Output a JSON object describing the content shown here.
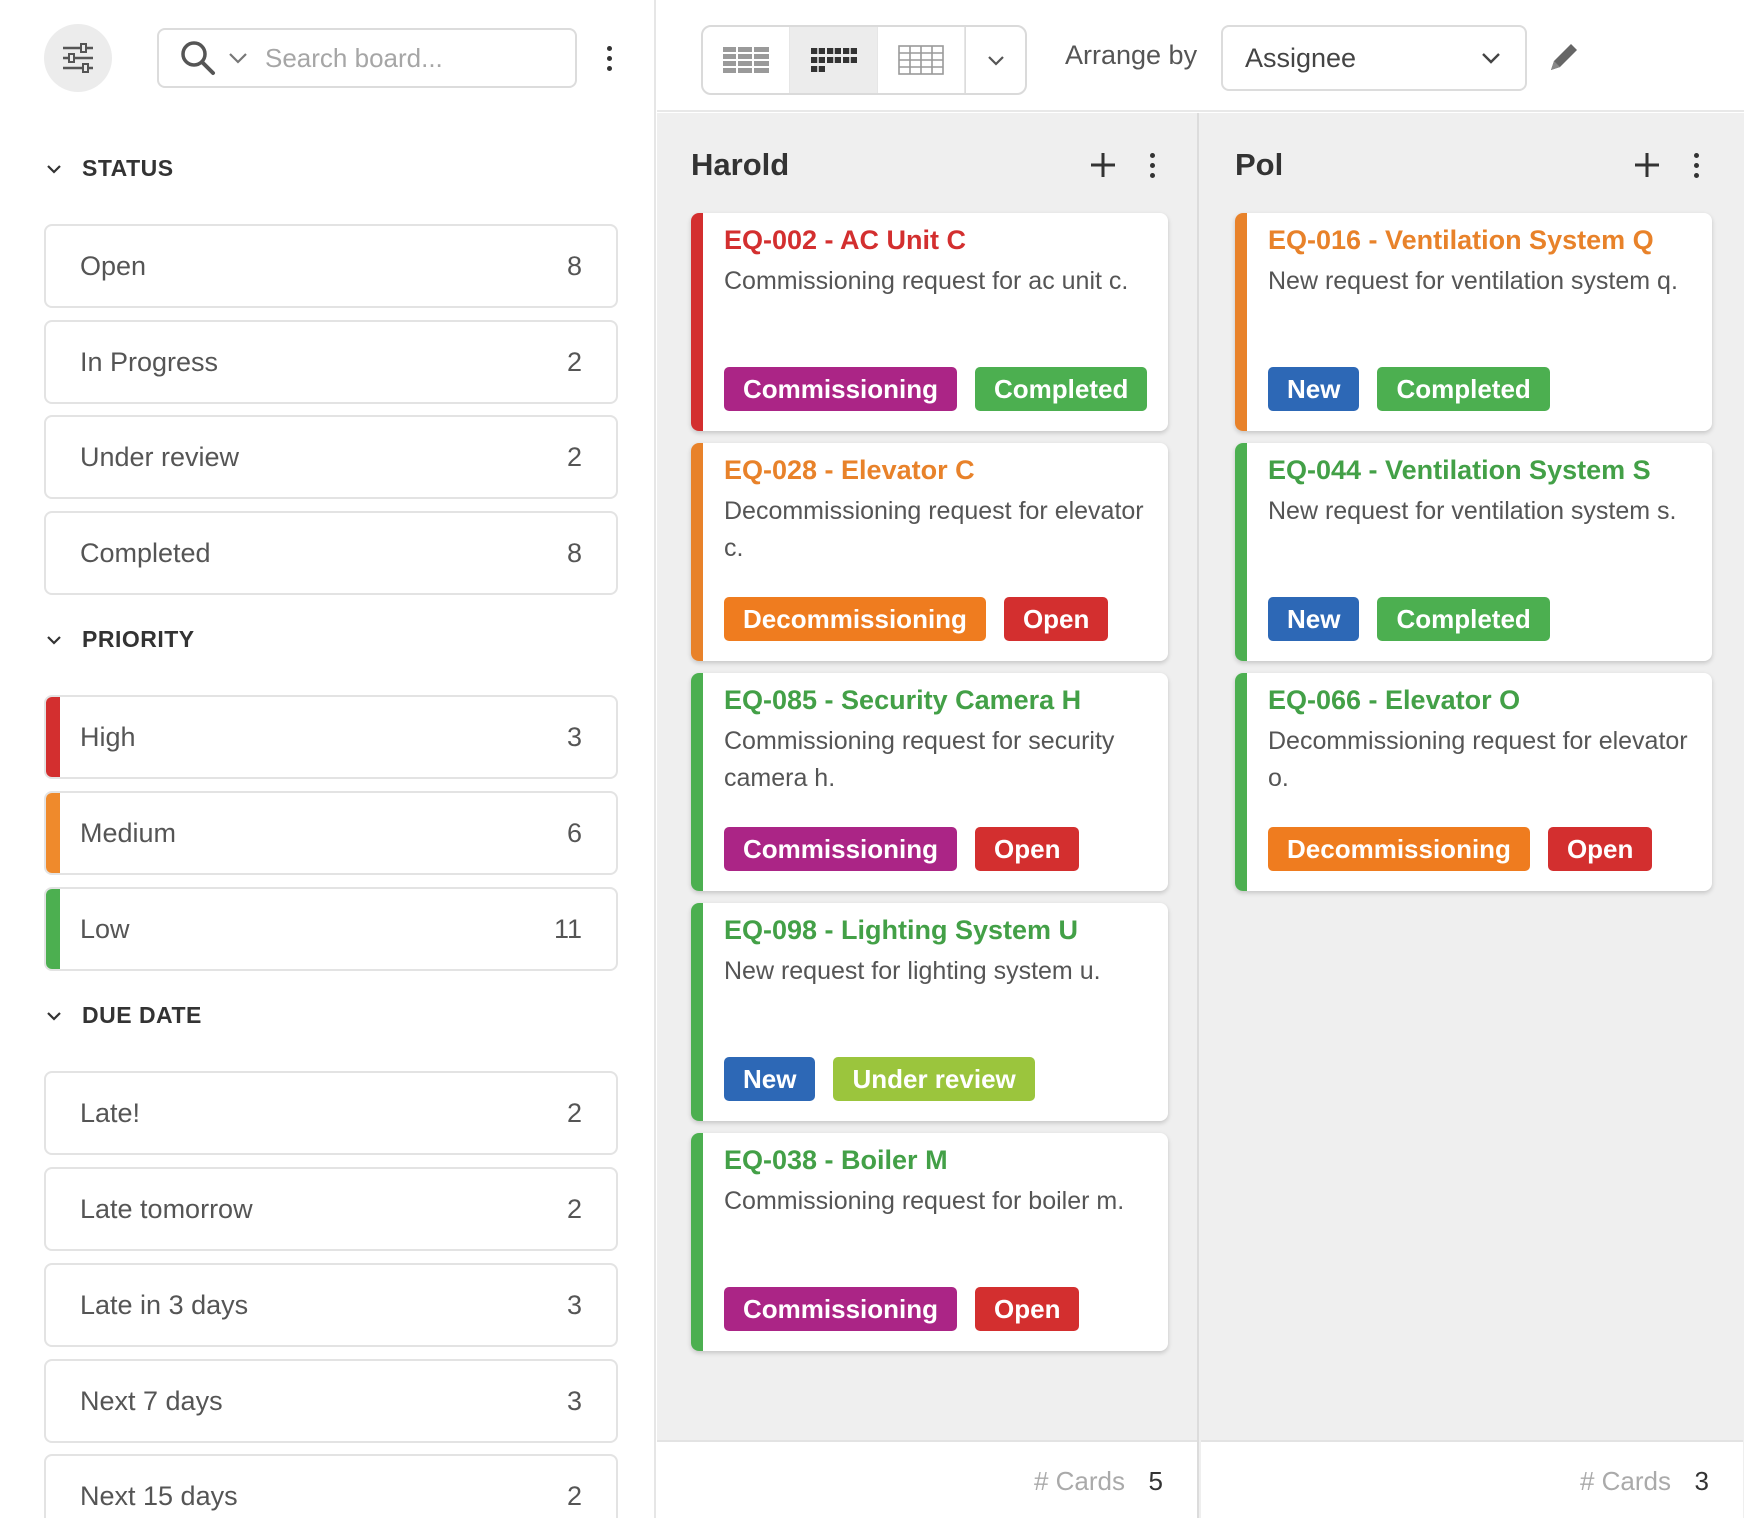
{
  "toolbar": {
    "search_placeholder": "Search board...",
    "arrange_label": "Arrange by",
    "arrange_value": "Assignee"
  },
  "sections": {
    "status": {
      "title": "STATUS",
      "items": [
        {
          "label": "Open",
          "count": "8"
        },
        {
          "label": "In Progress",
          "count": "2"
        },
        {
          "label": "Under review",
          "count": "2"
        },
        {
          "label": "Completed",
          "count": "8"
        }
      ]
    },
    "priority": {
      "title": "PRIORITY",
      "items": [
        {
          "label": "High",
          "count": "3",
          "color": "#d32f2f"
        },
        {
          "label": "Medium",
          "count": "6",
          "color": "#ef8a2c"
        },
        {
          "label": "Low",
          "count": "11",
          "color": "#4caf50"
        }
      ]
    },
    "due_date": {
      "title": "DUE DATE",
      "items": [
        {
          "label": "Late!",
          "count": "2"
        },
        {
          "label": "Late tomorrow",
          "count": "2"
        },
        {
          "label": "Late in 3 days",
          "count": "3"
        },
        {
          "label": "Next 7 days",
          "count": "3"
        },
        {
          "label": "Next 15 days",
          "count": "2"
        }
      ]
    }
  },
  "colors": {
    "high": "#d32f2f",
    "medium": "#e8822a",
    "low": "#4caf50",
    "commissioning": "#ab2586",
    "decommissioning": "#ef7c1f",
    "completed": "#4caf50",
    "open": "#d32f2f",
    "new": "#2d68b6",
    "under_review": "#9bc53d"
  },
  "columns": [
    {
      "name": "Harold",
      "cards_label": "# Cards",
      "cards_count": "5",
      "cards": [
        {
          "title": "EQ-002 - AC Unit C",
          "desc": "Commissioning request for ac unit c.",
          "priority_color": "#d32f2f",
          "tags": [
            {
              "label": "Commissioning",
              "color": "#ab2586"
            },
            {
              "label": "Completed",
              "color": "#4caf50"
            }
          ]
        },
        {
          "title": "EQ-028 - Elevator C",
          "desc": "Decommissioning request for elevator c.",
          "priority_color": "#e8822a",
          "tags": [
            {
              "label": "Decommissioning",
              "color": "#ef7c1f"
            },
            {
              "label": "Open",
              "color": "#d32f2f"
            }
          ]
        },
        {
          "title": "EQ-085 - Security Camera H",
          "desc": "Commissioning request for security camera h.",
          "priority_color": "#4caf50",
          "tags": [
            {
              "label": "Commissioning",
              "color": "#ab2586"
            },
            {
              "label": "Open",
              "color": "#d32f2f"
            }
          ]
        },
        {
          "title": "EQ-098 - Lighting System U",
          "desc": "New request for lighting system u.",
          "priority_color": "#4caf50",
          "tags": [
            {
              "label": "New",
              "color": "#2d68b6"
            },
            {
              "label": "Under review",
              "color": "#9bc53d"
            }
          ]
        },
        {
          "title": "EQ-038 - Boiler M",
          "desc": "Commissioning request for boiler m.",
          "priority_color": "#4caf50",
          "tags": [
            {
              "label": "Commissioning",
              "color": "#ab2586"
            },
            {
              "label": "Open",
              "color": "#d32f2f"
            }
          ]
        }
      ]
    },
    {
      "name": "Pol",
      "cards_label": "# Cards",
      "cards_count": "3",
      "cards": [
        {
          "title": "EQ-016 - Ventilation System Q",
          "desc": "New request for ventilation system q.",
          "priority_color": "#e8822a",
          "tags": [
            {
              "label": "New",
              "color": "#2d68b6"
            },
            {
              "label": "Completed",
              "color": "#4caf50"
            }
          ]
        },
        {
          "title": "EQ-044 - Ventilation System S",
          "desc": "New request for ventilation system s.",
          "priority_color": "#4caf50",
          "tags": [
            {
              "label": "New",
              "color": "#2d68b6"
            },
            {
              "label": "Completed",
              "color": "#4caf50"
            }
          ]
        },
        {
          "title": "EQ-066 - Elevator O",
          "desc": "Decommissioning request for elevator o.",
          "priority_color": "#4caf50",
          "tags": [
            {
              "label": "Decommissioning",
              "color": "#ef7c1f"
            },
            {
              "label": "Open",
              "color": "#d32f2f"
            }
          ]
        }
      ]
    }
  ],
  "icons": {
    "filter": "sliders-icon",
    "search": "search-icon",
    "chevron": "chevron-down-icon",
    "more": "kebab-menu-icon",
    "add": "plus-icon",
    "edit": "pencil-icon",
    "views": [
      "table-view-icon",
      "board-view-icon",
      "grid-view-icon"
    ]
  }
}
